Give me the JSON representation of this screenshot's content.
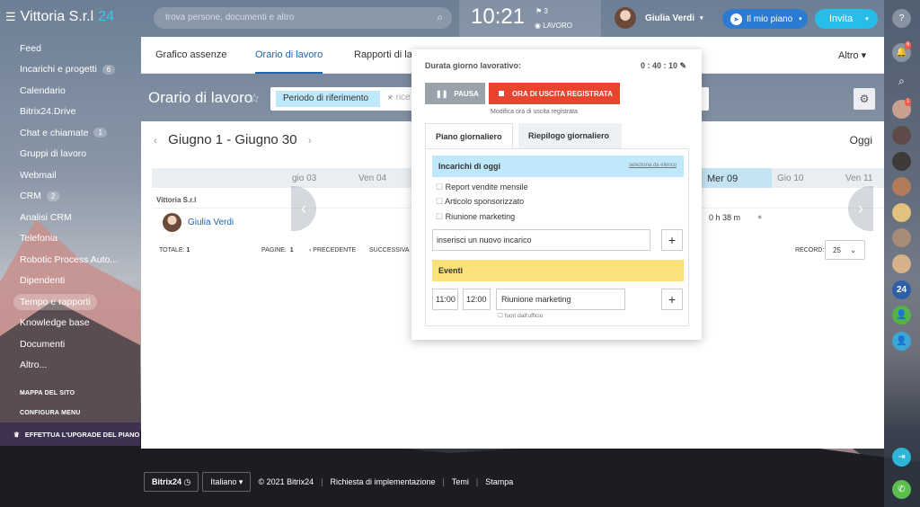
{
  "header": {
    "company": "Vittoria S.r.l",
    "company_suffix": "24",
    "search_placeholder": "trova persone, documenti e altro",
    "time": "10:21",
    "flag_count": "3",
    "status": "LAVORO",
    "user_name": "Giulia Verdi",
    "plan_label": "Il mio piano",
    "invite_label": "Invita"
  },
  "sidebar": {
    "items": [
      {
        "label": "Feed",
        "count": ""
      },
      {
        "label": "Incarichi e progetti",
        "count": "6"
      },
      {
        "label": "Calendario",
        "count": ""
      },
      {
        "label": "Bitrix24.Drive",
        "count": ""
      },
      {
        "label": "Chat e chiamate",
        "count": "1"
      },
      {
        "label": "Gruppi di lavoro",
        "count": ""
      },
      {
        "label": "Webmail",
        "count": ""
      },
      {
        "label": "CRM",
        "count": "2"
      },
      {
        "label": "Analisi CRM",
        "count": ""
      },
      {
        "label": "Telefonia",
        "count": ""
      },
      {
        "label": "Robotic Process Auto...",
        "count": ""
      },
      {
        "label": "Dipendenti",
        "count": ""
      },
      {
        "label": "Tempo e rapporti",
        "count": ""
      },
      {
        "label": "Knowledge base",
        "count": ""
      },
      {
        "label": "Documenti",
        "count": ""
      },
      {
        "label": "Altro...",
        "count": ""
      }
    ],
    "site_map": "MAPPA DEL SITO",
    "configure": "CONFIGURA MENU",
    "upgrade": "EFFETTUA L'UPGRADE DEL PIANO"
  },
  "tabs": [
    "Grafico assenze",
    "Orario di lavoro",
    "Rapporti di la",
    "Altro"
  ],
  "page_title": "Orario di lavoro",
  "filter": {
    "chip": "Periodo di riferimento",
    "placeholder": "+ rice"
  },
  "calendar": {
    "range": "Giugno 1 - Giugno 30",
    "today": "Oggi",
    "days": [
      "gio 03",
      "Ven 04",
      "Mer 09",
      "Gio 10",
      "Ven 11"
    ],
    "company_row": "Vittoria S.r.l",
    "user": "Giulia Verdi",
    "cell_value": "0 h 38 m",
    "totale_label": "TOTALE:",
    "totale": "1",
    "pagine_label": "PAGINE:",
    "pagine": "1",
    "prev": "‹ PRECEDENTE",
    "next": "SUCCESSIVA",
    "record_label": "RECORD:",
    "record_value": "25"
  },
  "popup": {
    "duration_label": "Durata giorno lavorativo:",
    "duration": "0 : 40 : 10",
    "pause": "PAUSA",
    "stop": "ORA DI USCITA REGISTRATA",
    "modify_note": "Modifica ora di uscita registrata",
    "tab_daily_plan": "Piano giornaliero",
    "tab_daily_summary": "Riepilogo giornaliero",
    "tasks_title": "Incarichi di oggi",
    "select_list": "seleziona da elenco",
    "tasks": [
      "Report vendite mensile",
      "Articolo sponsorizzato",
      "Riunione marketing"
    ],
    "new_task_placeholder": "inserisci un nuovo incarico",
    "events_title": "Eventi",
    "event_start": "11:00",
    "event_end": "12:00",
    "event_name": "Riunione marketing",
    "out_of_office": "fuori dall'ufficio"
  },
  "footer": {
    "brand": "Bitrix24",
    "language": "Italiano",
    "copyright": "© 2021 Bitrix24",
    "impl": "Richiesta di implementazione",
    "themes": "Temi",
    "print": "Stampa"
  },
  "colors": {
    "accent": "#2066b0",
    "brand": "#36c6f4",
    "stop": "#e8442e",
    "tasks": "#bfe8fa",
    "events": "#fae17a"
  }
}
